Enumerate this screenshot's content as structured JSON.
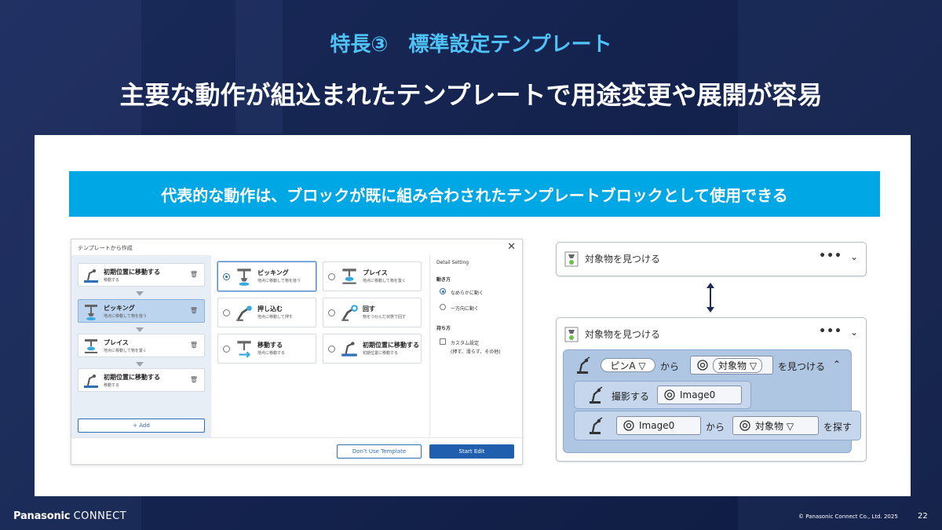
{
  "header": {
    "subtitle": "特長③　標準設定テンプレート",
    "title": "主要な動作が組込まれたテンプレートで用途変更や展開が容易"
  },
  "banner": {
    "text": "代表的な動作は、ブロックが既に組み合わされたテンプレートブロックとして使用できる"
  },
  "dialog": {
    "title": "テンプレートから作成",
    "close": "✕",
    "left_items": [
      {
        "title": "初期位置に移動する",
        "desc": "移動する"
      },
      {
        "title": "ピッキング",
        "desc": "地点に移動して物を拾う"
      },
      {
        "title": "プレイス",
        "desc": "地点に移動して物を置く"
      },
      {
        "title": "初期位置に移動する",
        "desc": "移動する"
      }
    ],
    "trash": "🗑",
    "add_label": "+ Add",
    "options": [
      {
        "title": "ピッキング",
        "desc": "地点に移動して物を拾う"
      },
      {
        "title": "プレイス",
        "desc": "地点に移動して物を置く"
      },
      {
        "title": "押し込む",
        "desc": "地点に移動して押す"
      },
      {
        "title": "回す",
        "desc": "物をつかんだ状態で回す"
      },
      {
        "title": "移動する",
        "desc": "地点に移動する"
      },
      {
        "title": "初期位置に移動する",
        "desc": "初期位置に移動する"
      }
    ],
    "detail": {
      "heading": "Detail Setting",
      "motion_label": "動き方",
      "motion_opts": [
        "なめらかに動く",
        "一方向に動く"
      ],
      "hold_label": "持ち方",
      "custom_label": "カスタム設定",
      "custom_note": "(押す、滑らす、その他)"
    },
    "btn_dont": "Don't Use Template",
    "btn_start": "Start Edit"
  },
  "block_top": {
    "title": "対象物を見つける",
    "dots": "•••",
    "chevron": "⌄"
  },
  "block_bottom": {
    "title": "対象物を見つける",
    "dots": "•••",
    "chevron": "⌄",
    "row1": {
      "pin": "ピンA ▽",
      "kara": "から",
      "target": "対象物 ▽",
      "find": "を見つける",
      "caret": "⌃"
    },
    "row2": {
      "shoot": "撮影する",
      "image": "Image0"
    },
    "row3": {
      "image": "Image0",
      "kara": "から",
      "target": "対象物 ▽",
      "search": "を探す"
    }
  },
  "footer": {
    "brand": "Panasonic",
    "brand2": "CONNECT",
    "copyright": "© Panasonic Connect Co., Ltd.  2025",
    "page": "22"
  },
  "colors": {
    "banner": "#00a7e5",
    "subtitle": "#4fc3f7",
    "primary_button": "#1f5fae",
    "block_fill": "#afc6e3"
  }
}
